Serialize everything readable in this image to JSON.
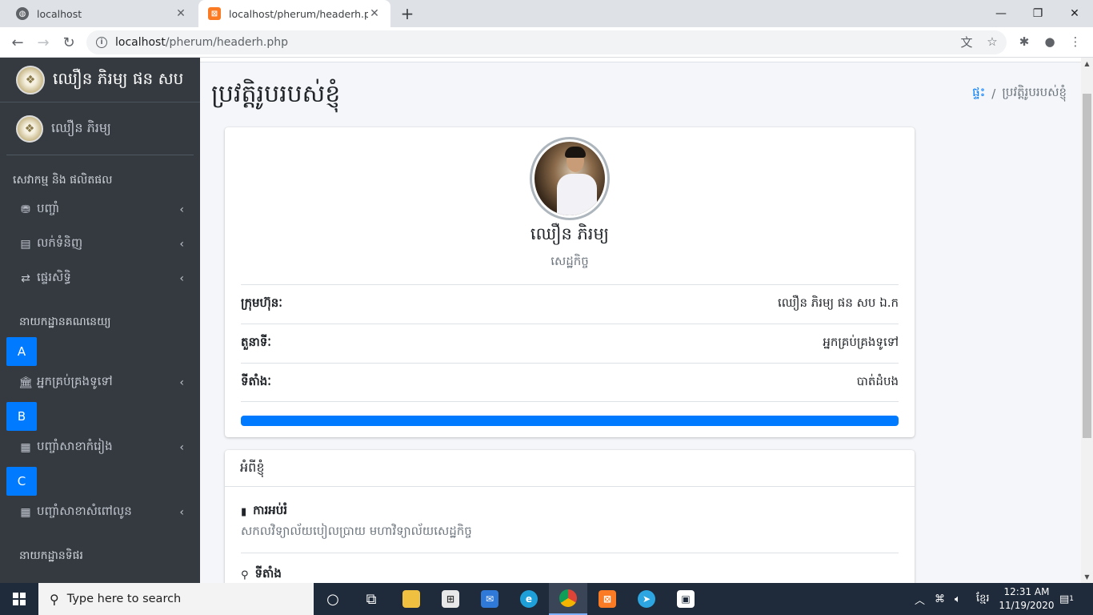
{
  "browser": {
    "tabs": [
      {
        "title": "localhost",
        "active": false
      },
      {
        "title": "localhost/pherum/headerh.php",
        "active": true
      }
    ],
    "url_host": "localhost",
    "url_path": "/pherum/headerh.php"
  },
  "sidebar": {
    "brand": "ឈឿន ភិរម្យ ផន សប",
    "user": "ឈឿន ភិរម្យ",
    "section1": "សេវាកម្ម និង ផលិតផល",
    "items1": [
      {
        "label": "បញ្ចាំ",
        "icon": "coins-icon"
      },
      {
        "label": "លក់ទំនិញ",
        "icon": "store-icon"
      },
      {
        "label": "ផ្ទេរសិទ្ធិ",
        "icon": "exchange-icon"
      }
    ],
    "section2": "នាយកដ្ឋានគណនេយ្យ",
    "letters": [
      "A",
      "B",
      "C"
    ],
    "items2": [
      {
        "label": "អ្នកគ្រប់គ្រងទូទៅ",
        "icon": "bank-icon"
      },
      {
        "label": "បញ្ចាំសាខាកំរៀង",
        "icon": "building-icon"
      },
      {
        "label": "បញ្ចាំសាខាសំពៅលូន",
        "icon": "building-icon"
      }
    ],
    "section3": "នាយកដ្ឋានទិផរ"
  },
  "page": {
    "title": "ប្រវត្តិរូបរបស់ខ្ញុំ",
    "breadcrumb_home": "ផ្ទះ",
    "breadcrumb_sep": "/",
    "breadcrumb_current": "ប្រវត្តិរូបរបស់ខ្ញុំ"
  },
  "profile": {
    "name": "ឈឿន ភិរម្យ",
    "role": "សេដ្ឋកិច្ច",
    "rows": [
      {
        "key": "ក្រុមហ៊ុនៈ",
        "value": "ឈឿន ភិរម្យ ផន សប ឯ.ក"
      },
      {
        "key": "តួនាទីៈ",
        "value": "អ្នកគ្រប់គ្រងទូទៅ"
      },
      {
        "key": "ទីតាំងៈ",
        "value": "បាត់ដំបង"
      }
    ],
    "progress": 1.0
  },
  "about": {
    "header": "អំពីខ្ញុំ",
    "education_title": "ការអប់រំ",
    "education_text": "សកលវិទ្យាល័យបៀលប្រាយ មហាវិទ្យាល័យសេដ្ឋកិច្ច",
    "location_title": "ទីតាំង"
  },
  "taskbar": {
    "search_placeholder": "Type here to search",
    "time": "12:31 AM",
    "date": "11/19/2020",
    "lang": "ខ្មែរ",
    "notif_count": "1"
  },
  "colors": {
    "sidebar_bg": "#343a40",
    "accent": "#007bff",
    "content_bg": "#f4f6f9"
  }
}
